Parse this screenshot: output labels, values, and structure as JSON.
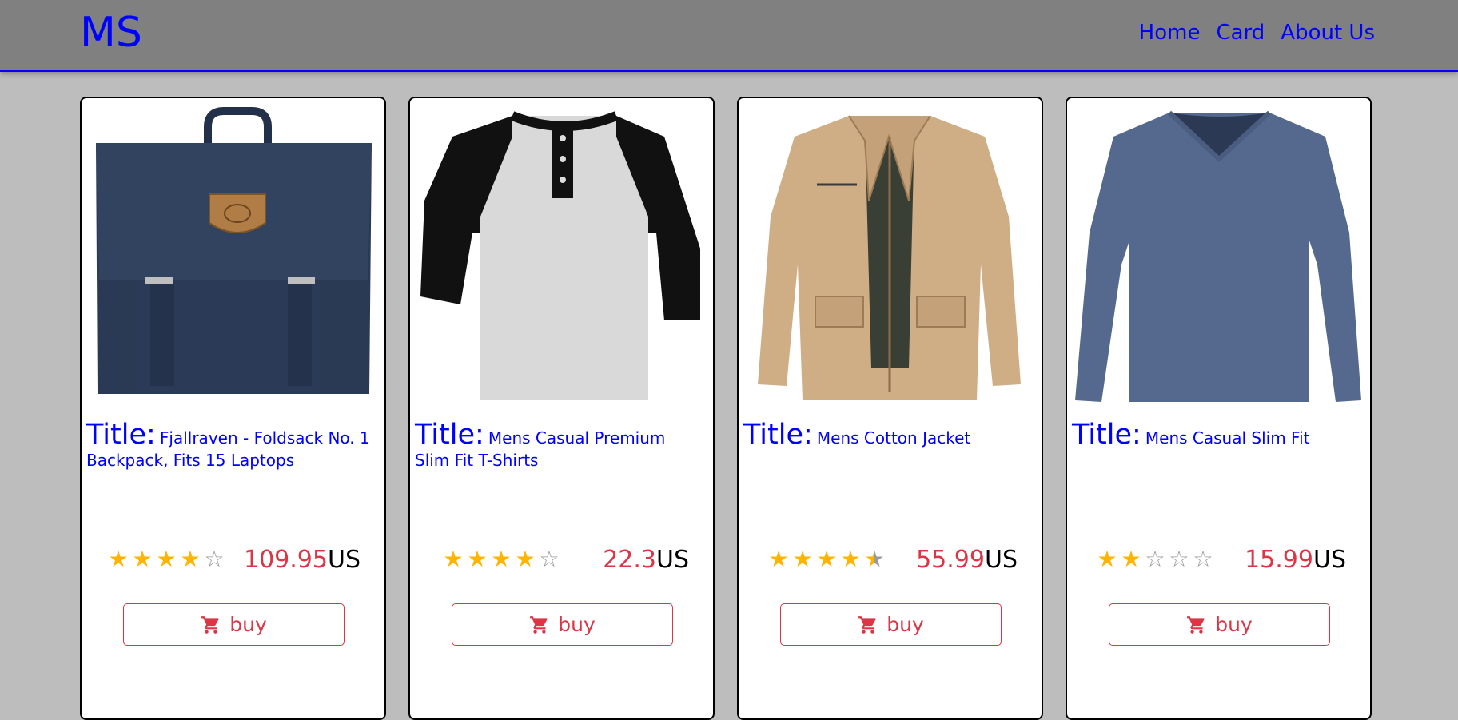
{
  "navbar": {
    "brand": "MS",
    "links": [
      "Home",
      "Card",
      "About Us"
    ],
    "accent_color": "#0000ff"
  },
  "products": [
    {
      "title_label": "Title:",
      "title": "Fjallraven - Foldsack No. 1 Backpack, Fits 15 Laptops",
      "rating": 4,
      "price": "109.95",
      "currency": "US",
      "buy_label": "buy",
      "image": "backpack"
    },
    {
      "title_label": "Title:",
      "title": "Mens Casual Premium Slim Fit T-Shirts",
      "rating": 4,
      "price": "22.3",
      "currency": "US",
      "buy_label": "buy",
      "image": "raglan-tshirt"
    },
    {
      "title_label": "Title:",
      "title": "Mens Cotton Jacket",
      "rating": 4.5,
      "price": "55.99",
      "currency": "US",
      "buy_label": "buy",
      "image": "cotton-jacket"
    },
    {
      "title_label": "Title:",
      "title": "Mens Casual Slim Fit",
      "rating": 2,
      "price": "15.99",
      "currency": "US",
      "buy_label": "buy",
      "image": "long-sleeve-shirt"
    }
  ],
  "colors": {
    "price": "#dc3545",
    "star": "#ffb400",
    "button": "#dc3545"
  }
}
